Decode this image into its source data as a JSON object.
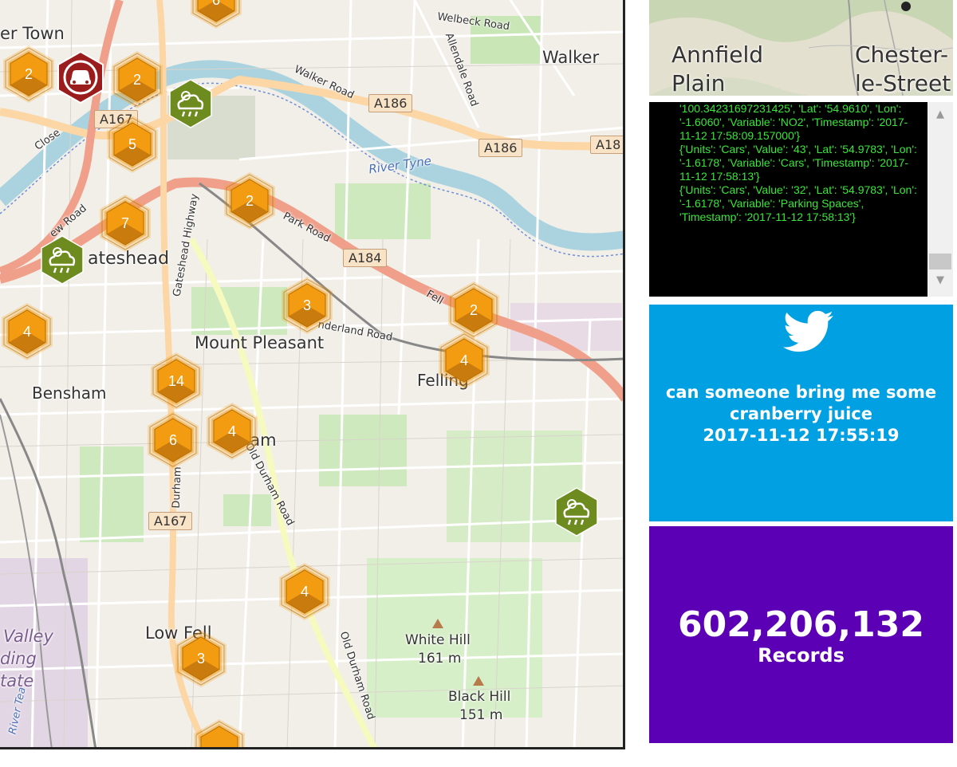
{
  "map": {
    "places": {
      "walker": "Walker",
      "gateshead": "ateshead",
      "mount_pleasant": "Mount Pleasant",
      "bensham": "Bensham",
      "felling": "Felling",
      "low_fell": "Low Fell",
      "white_hill": "White Hill",
      "white_hill_elev": "161 m",
      "black_hill": "Black Hill",
      "black_hill_elev": "151 m",
      "town": "er Town",
      "ham": "ham",
      "valley": "Valley",
      "ding": "ding",
      "tate": "tate"
    },
    "roads": {
      "welbeck": "Welbeck Road",
      "walker_road": "Walker Road",
      "allendale": "Allendale Road",
      "park": "Park Road",
      "sunderland": "nderland Road",
      "gateshead_hw": "Gateshead Highway",
      "old_durham": "Old Durham Road",
      "old_durham2": "Old Durham Road",
      "durham": "Durham",
      "close": "Close",
      "new_road": "ew Road",
      "fell": "Fell",
      "river": "River Tyne",
      "river_team": "River Tea"
    },
    "shields": {
      "a186_1": "A186",
      "a186_2": "A186",
      "a18": "A18",
      "a184": "A184",
      "a167_1": "A167",
      "a167_2": "A167"
    },
    "clusters": [
      {
        "count": "6"
      },
      {
        "count": "2"
      },
      {
        "count": "2"
      },
      {
        "count": "5"
      },
      {
        "count": "2"
      },
      {
        "count": "7"
      },
      {
        "count": "4"
      },
      {
        "count": "3"
      },
      {
        "count": "2"
      },
      {
        "count": "4"
      },
      {
        "count": "14"
      },
      {
        "count": "6"
      },
      {
        "count": "4"
      },
      {
        "count": "4"
      },
      {
        "count": "3"
      },
      {
        "count": ""
      }
    ],
    "colors": {
      "cluster": "#f39c12",
      "traffic": "#9b1c1c",
      "weather": "#6e8b1f"
    },
    "icons": {
      "traffic": "car-icon",
      "weather": "rain-cloud-icon"
    }
  },
  "mini_map": {
    "annfield_1": "Annfield",
    "annfield_2": "Plain",
    "chester_1": "Chester-",
    "chester_2": "le-Street"
  },
  "log": {
    "entries": [
      "'100.34231697231425', 'Lat': '54.9610', 'Lon': '-1.6060', 'Variable': 'NO2', 'Timestamp': '2017-11-12 17:58:09.157000'}",
      "{'Units': 'Cars', 'Value': '43', 'Lat': '54.9783', 'Lon': '-1.6178', 'Variable': 'Cars', 'Timestamp': '2017-11-12 17:58:13'}",
      "{'Units': 'Cars', 'Value': '32', 'Lat': '54.9783', 'Lon': '-1.6178', 'Variable': 'Parking Spaces', 'Timestamp': '2017-11-12 17:58:13'}"
    ]
  },
  "tweet": {
    "line1": "can someone bring me some",
    "line2": "cranberry juice",
    "timestamp": "2017-11-12 17:55:19",
    "icon": "twitter-bird-icon",
    "background": "#00a0e2"
  },
  "records": {
    "count": "602,206,132",
    "label": "Records",
    "background": "#5b00b4"
  }
}
